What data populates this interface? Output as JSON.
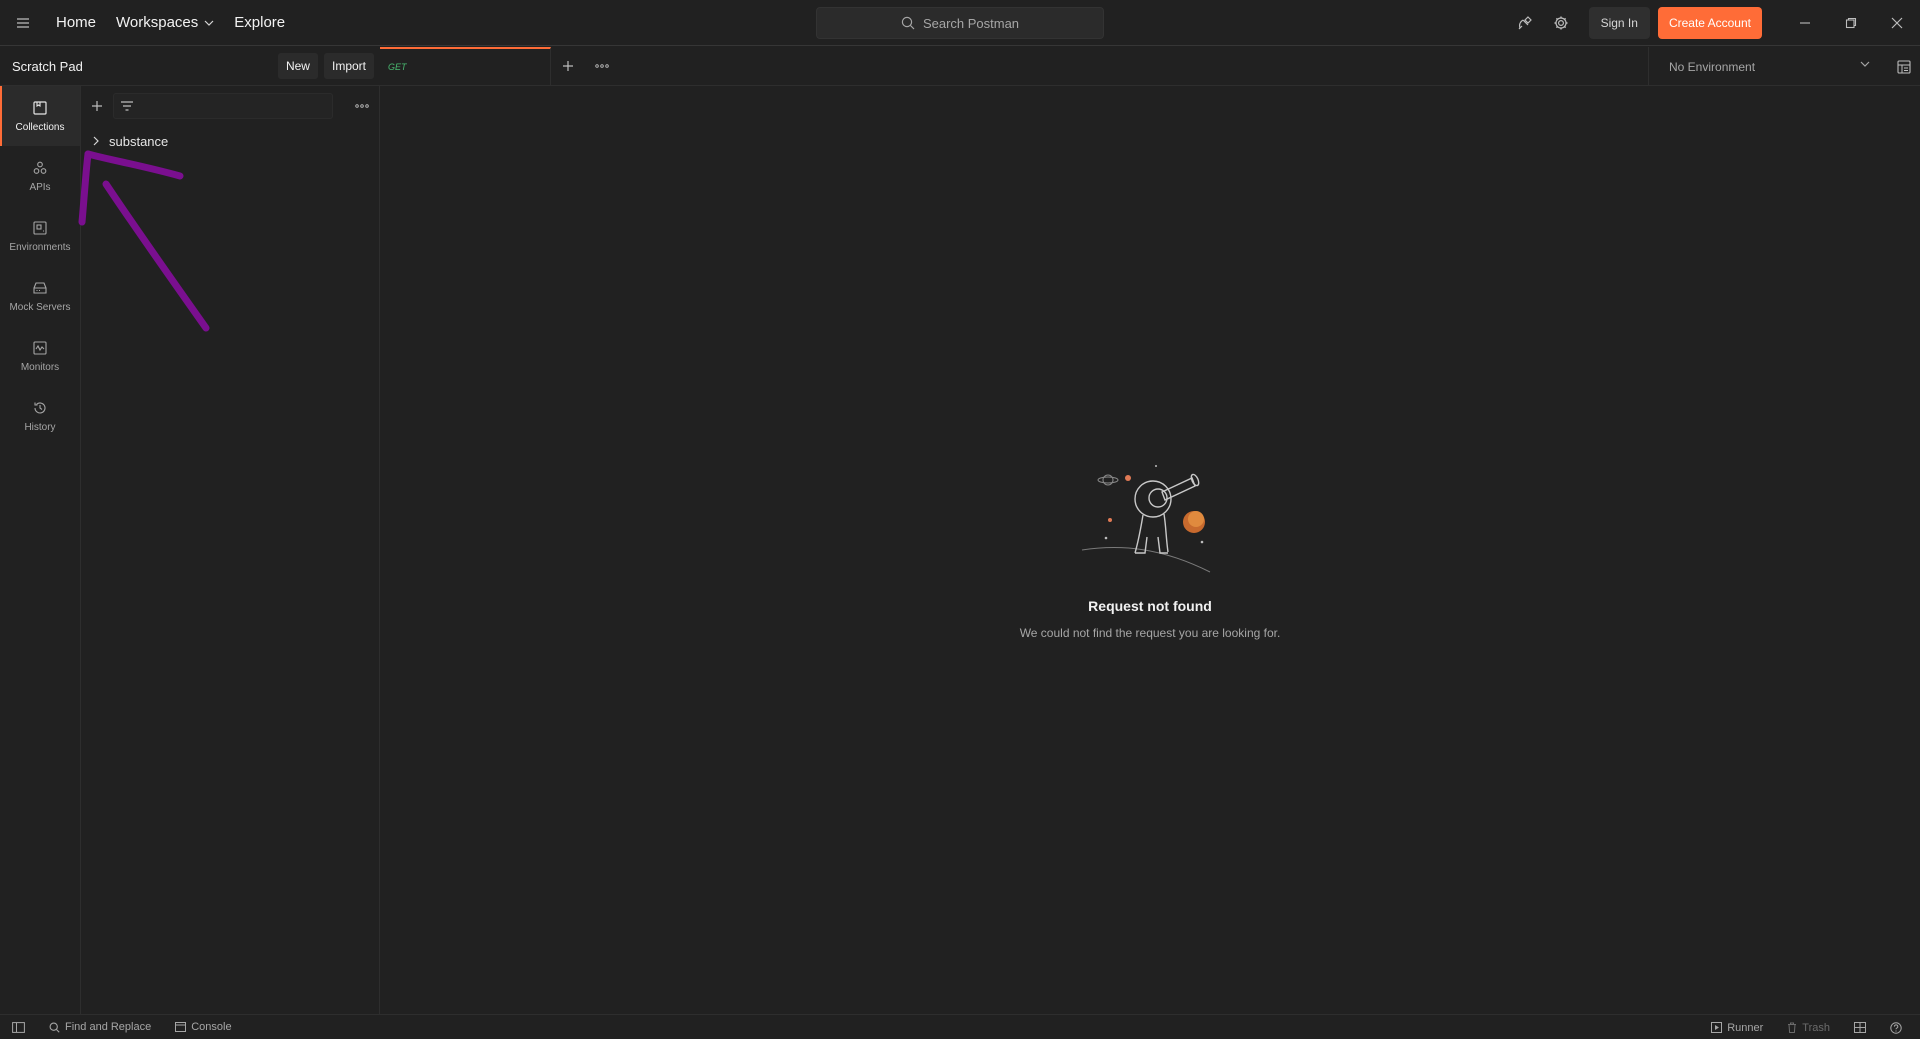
{
  "topbar": {
    "nav": {
      "home": "Home",
      "workspaces": "Workspaces",
      "explore": "Explore"
    },
    "search_label": "Search Postman",
    "sign_in": "Sign In",
    "create_account": "Create Account",
    "icons": [
      "menu-icon",
      "satellite-icon",
      "gear-icon",
      "minimize-icon",
      "restore-icon",
      "close-icon"
    ]
  },
  "workspace": {
    "title": "Scratch Pad",
    "new_label": "New",
    "import_label": "Import"
  },
  "rail": {
    "items": [
      {
        "label": "Collections",
        "icon": "collections-icon",
        "active": true
      },
      {
        "label": "APIs",
        "icon": "apis-icon",
        "active": false
      },
      {
        "label": "Environments",
        "icon": "environments-icon",
        "active": false
      },
      {
        "label": "Mock Servers",
        "icon": "mock-servers-icon",
        "active": false
      },
      {
        "label": "Monitors",
        "icon": "monitors-icon",
        "active": false
      },
      {
        "label": "History",
        "icon": "history-icon",
        "active": false
      }
    ]
  },
  "sidebar": {
    "filter_value": "",
    "collections": [
      {
        "name": "substance"
      }
    ]
  },
  "tabs": {
    "items": [
      {
        "method": "GET",
        "title": ""
      }
    ]
  },
  "environment": {
    "selected": "No Environment"
  },
  "main": {
    "empty_title": "Request not found",
    "empty_subtitle": "We could not find the request you are looking for."
  },
  "statusbar": {
    "find_replace": "Find and Replace",
    "console": "Console",
    "runner": "Runner",
    "trash": "Trash"
  },
  "colors": {
    "background": "#212121",
    "accent": "#ff6c37",
    "get_method": "#49b86f",
    "annotation": "#7a0f8f"
  }
}
